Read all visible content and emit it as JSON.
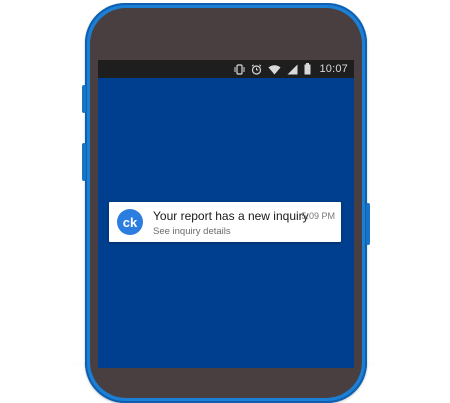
{
  "status_bar": {
    "time": "10:07",
    "icons": [
      "vibrate-icon",
      "alarm-icon",
      "wifi-icon",
      "signal-icon",
      "battery-icon"
    ]
  },
  "notification": {
    "avatar_text": "ck",
    "title": "Your report has a new inquiry",
    "subtitle": "See inquiry details",
    "time": "5:09 PM"
  },
  "colors": {
    "phone_frame": "#1c7fd6",
    "phone_bezel": "#4a3f40",
    "screen_background": "#003f8f",
    "status_bar": "#1e1e1e",
    "avatar": "#2c7de0"
  }
}
